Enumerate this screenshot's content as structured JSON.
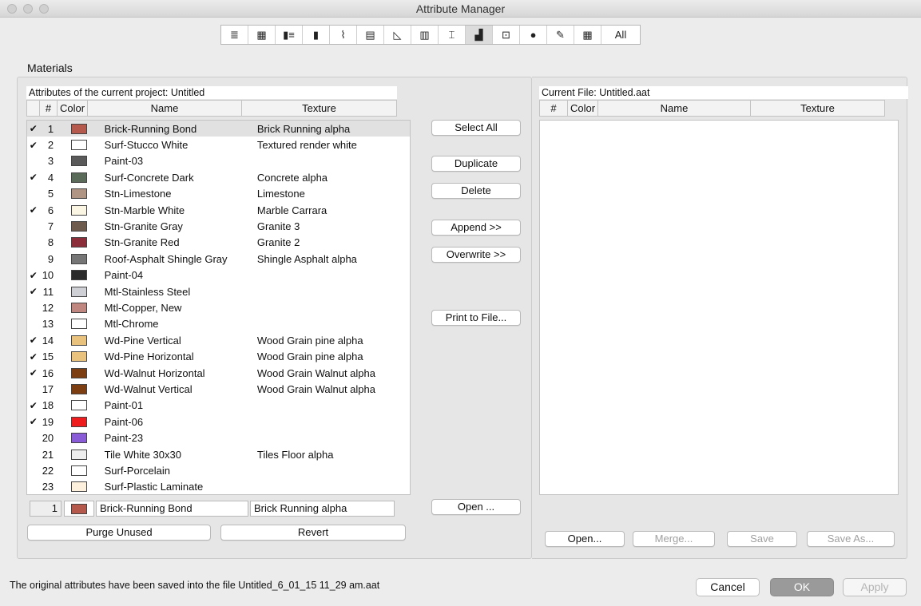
{
  "window": {
    "title": "Attribute Manager"
  },
  "iconbar": {
    "items": [
      {
        "name": "layers-icon",
        "glyph": "≣"
      },
      {
        "name": "layer-combos-icon",
        "glyph": "▦"
      },
      {
        "name": "pens-icon",
        "glyph": "▮≡"
      },
      {
        "name": "pen-sets-icon",
        "glyph": "▮"
      },
      {
        "name": "line-types-icon",
        "glyph": "⌇"
      },
      {
        "name": "fill-types-icon",
        "glyph": "▤"
      },
      {
        "name": "composites-icon",
        "glyph": "◺"
      },
      {
        "name": "profiles-icon",
        "glyph": "▥"
      },
      {
        "name": "zones-icon",
        "glyph": "⌶"
      },
      {
        "name": "materials-icon",
        "glyph": "▟"
      },
      {
        "name": "mep-icon",
        "glyph": "⊡"
      },
      {
        "name": "cities-icon",
        "glyph": "●"
      },
      {
        "name": "markup-icon",
        "glyph": "✎"
      },
      {
        "name": "palette-icon",
        "glyph": "▦"
      }
    ],
    "all_label": "All",
    "active_index": 9
  },
  "section_title": "Materials",
  "left": {
    "caption": "Attributes of the current project: Untitled",
    "columns": {
      "num": "#",
      "color": "Color",
      "name": "Name",
      "texture": "Texture"
    },
    "rows": [
      {
        "checked": "✔",
        "num": "1",
        "color": "#b5594c",
        "name": "Brick-Running Bond",
        "texture": "Brick Running alpha"
      },
      {
        "checked": "✔",
        "num": "2",
        "color": "#ffffff",
        "name": "Surf-Stucco White",
        "texture": "Textured render white"
      },
      {
        "checked": "",
        "num": "3",
        "color": "#5a5a5a",
        "name": "Paint-03",
        "texture": ""
      },
      {
        "checked": "✔",
        "num": "4",
        "color": "#5b6b5a",
        "name": "Surf-Concrete Dark",
        "texture": "Concrete alpha"
      },
      {
        "checked": "",
        "num": "5",
        "color": "#b09484",
        "name": "Stn-Limestone",
        "texture": "Limestone"
      },
      {
        "checked": "✔",
        "num": "6",
        "color": "#fbf6e3",
        "name": "Stn-Marble White",
        "texture": "Marble Carrara"
      },
      {
        "checked": "",
        "num": "7",
        "color": "#6e5b4d",
        "name": "Stn-Granite Gray",
        "texture": "Granite 3"
      },
      {
        "checked": "",
        "num": "8",
        "color": "#8b2e3a",
        "name": "Stn-Granite Red",
        "texture": "Granite 2"
      },
      {
        "checked": "",
        "num": "9",
        "color": "#767676",
        "name": "Roof-Asphalt Shingle Gray",
        "texture": "Shingle Asphalt alpha"
      },
      {
        "checked": "✔",
        "num": "10",
        "color": "#2b2b2b",
        "name": "Paint-04",
        "texture": ""
      },
      {
        "checked": "✔",
        "num": "11",
        "color": "#cfd0d6",
        "name": "Mtl-Stainless Steel",
        "texture": ""
      },
      {
        "checked": "",
        "num": "12",
        "color": "#c08680",
        "name": "Mtl-Copper, New",
        "texture": ""
      },
      {
        "checked": "",
        "num": "13",
        "color": "#ffffff",
        "name": "Mtl-Chrome",
        "texture": ""
      },
      {
        "checked": "✔",
        "num": "14",
        "color": "#e9c27e",
        "name": "Wd-Pine Vertical",
        "texture": "Wood Grain pine alpha"
      },
      {
        "checked": "✔",
        "num": "15",
        "color": "#e9c27e",
        "name": "Wd-Pine Horizontal",
        "texture": "Wood Grain pine alpha"
      },
      {
        "checked": "✔",
        "num": "16",
        "color": "#7d3f12",
        "name": "Wd-Walnut Horizontal",
        "texture": "Wood Grain Walnut alpha"
      },
      {
        "checked": "",
        "num": "17",
        "color": "#7d3f12",
        "name": "Wd-Walnut Vertical",
        "texture": "Wood Grain Walnut alpha"
      },
      {
        "checked": "✔",
        "num": "18",
        "color": "#ffffff",
        "name": "Paint-01",
        "texture": ""
      },
      {
        "checked": "✔",
        "num": "19",
        "color": "#ee1c1c",
        "name": "Paint-06",
        "texture": ""
      },
      {
        "checked": "",
        "num": "20",
        "color": "#8a5bd6",
        "name": "Paint-23",
        "texture": ""
      },
      {
        "checked": "",
        "num": "21",
        "color": "#eeeeee",
        "name": "Tile White 30x30",
        "texture": "Tiles Floor alpha"
      },
      {
        "checked": "",
        "num": "22",
        "color": "#ffffff",
        "name": "Surf-Porcelain",
        "texture": ""
      },
      {
        "checked": "",
        "num": "23",
        "color": "#fdf0dc",
        "name": "Surf-Plastic Laminate",
        "texture": ""
      }
    ],
    "editor": {
      "num": "1",
      "color": "#b5594c",
      "name": "Brick-Running Bond",
      "texture": "Brick Running alpha"
    },
    "purge_label": "Purge Unused",
    "revert_label": "Revert"
  },
  "middle": {
    "select_all": "Select All",
    "duplicate": "Duplicate",
    "delete": "Delete",
    "append": "Append >>",
    "overwrite": "Overwrite >>",
    "print": "Print to File...",
    "open": "Open ..."
  },
  "right": {
    "caption": "Current File: Untitled.aat",
    "columns": {
      "num": "#",
      "color": "Color",
      "name": "Name",
      "texture": "Texture"
    },
    "open": "Open...",
    "merge": "Merge...",
    "save": "Save",
    "save_as": "Save As..."
  },
  "footer": {
    "status": "The original attributes have been saved into the file Untitled_6_01_15 11_29 am.aat",
    "cancel": "Cancel",
    "ok": "OK",
    "apply": "Apply"
  }
}
